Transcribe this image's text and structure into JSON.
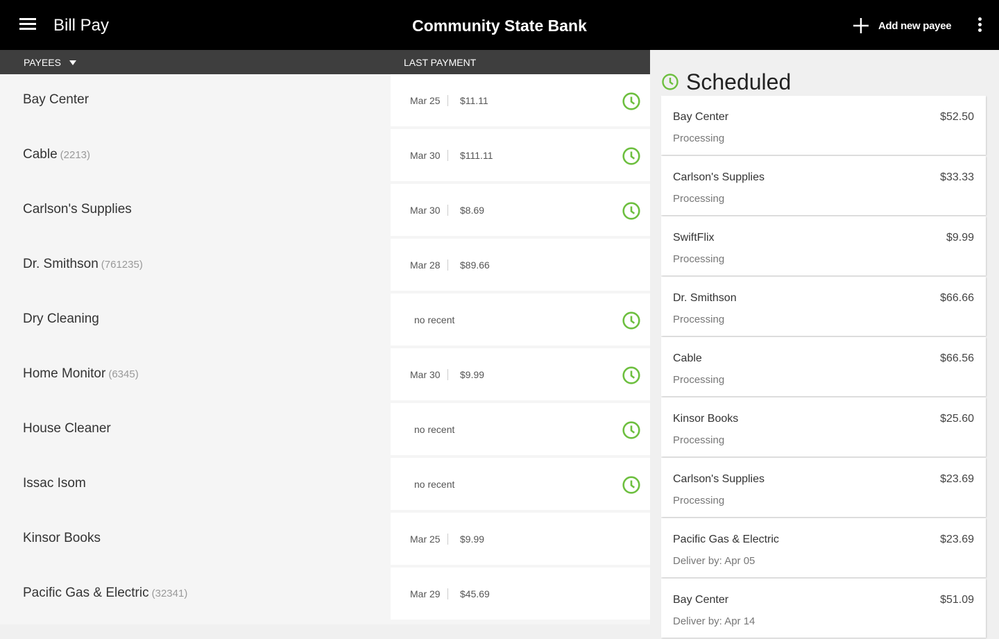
{
  "header": {
    "app_title": "Bill Pay",
    "bank_name": "Community State Bank",
    "add_payee_label": "Add new payee"
  },
  "columns": {
    "payees": "PAYEES",
    "last_payment": "LAST PAYMENT"
  },
  "payees": [
    {
      "name": "Bay Center",
      "account": "",
      "date": "Mar 25",
      "amount": "$11.11",
      "recent": "",
      "scheduled": true
    },
    {
      "name": "Cable",
      "account": "(2213)",
      "date": "Mar 30",
      "amount": "$111.11",
      "recent": "",
      "scheduled": true
    },
    {
      "name": "Carlson's Supplies",
      "account": "",
      "date": "Mar 30",
      "amount": "$8.69",
      "recent": "",
      "scheduled": true
    },
    {
      "name": "Dr. Smithson",
      "account": "(761235)",
      "date": "Mar 28",
      "amount": "$89.66",
      "recent": "",
      "scheduled": false
    },
    {
      "name": "Dry Cleaning",
      "account": "",
      "date": "",
      "amount": "",
      "recent": "no recent",
      "scheduled": true
    },
    {
      "name": "Home Monitor",
      "account": "(6345)",
      "date": "Mar 30",
      "amount": "$9.99",
      "recent": "",
      "scheduled": true
    },
    {
      "name": "House Cleaner",
      "account": "",
      "date": "",
      "amount": "",
      "recent": "no recent",
      "scheduled": true
    },
    {
      "name": "Issac Isom",
      "account": "",
      "date": "",
      "amount": "",
      "recent": "no recent",
      "scheduled": true
    },
    {
      "name": "Kinsor Books",
      "account": "",
      "date": "Mar 25",
      "amount": "$9.99",
      "recent": "",
      "scheduled": false
    },
    {
      "name": "Pacific Gas & Electric",
      "account": "(32341)",
      "date": "Mar 29",
      "amount": "$45.69",
      "recent": "",
      "scheduled": false
    }
  ],
  "scheduled": {
    "title": "Scheduled",
    "items": [
      {
        "name": "Bay Center",
        "amount": "$52.50",
        "status": "Processing"
      },
      {
        "name": "Carlson's Supplies",
        "amount": "$33.33",
        "status": "Processing"
      },
      {
        "name": "SwiftFlix",
        "amount": "$9.99",
        "status": "Processing"
      },
      {
        "name": "Dr. Smithson",
        "amount": "$66.66",
        "status": "Processing"
      },
      {
        "name": "Cable",
        "amount": "$66.56",
        "status": "Processing"
      },
      {
        "name": "Kinsor Books",
        "amount": "$25.60",
        "status": "Processing"
      },
      {
        "name": "Carlson's Supplies",
        "amount": "$23.69",
        "status": "Processing"
      },
      {
        "name": "Pacific Gas & Electric",
        "amount": "$23.69",
        "status": "Deliver by: Apr 05"
      },
      {
        "name": "Bay Center",
        "amount": "$51.09",
        "status": "Deliver by: Apr 14"
      }
    ]
  },
  "colors": {
    "accent_green": "#6dbf3f",
    "topbar": "#000000",
    "column_header": "#3e3e3e"
  },
  "icons": {
    "menu": "menu-icon",
    "add": "plus-icon",
    "overflow": "more-vert-icon",
    "schedule": "clock-icon",
    "sort": "caret-down-icon"
  }
}
